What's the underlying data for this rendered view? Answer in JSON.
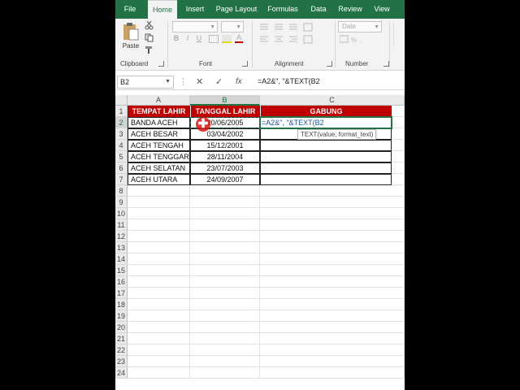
{
  "ribbon": {
    "tabs": [
      "File",
      "Home",
      "Insert",
      "Page Layout",
      "Formulas",
      "Data",
      "Review",
      "View"
    ],
    "active_tab": "Home",
    "groups": {
      "clipboard": "Clipboard",
      "font": "Font",
      "alignment": "Alignment",
      "number": "Number"
    },
    "paste_label": "Paste",
    "number_format": "Date",
    "bold": "B",
    "italic": "I",
    "underline": "U"
  },
  "formula_bar": {
    "name_box": "B2",
    "cancel": "✕",
    "enter": "✓",
    "fx": "fx",
    "formula": "=A2&\", \"&TEXT(B2"
  },
  "grid": {
    "columns": [
      "A",
      "B",
      "C"
    ],
    "rows": [
      "1",
      "2",
      "3",
      "4",
      "5",
      "6",
      "7",
      "8",
      "9",
      "10",
      "11",
      "12",
      "13",
      "14",
      "15",
      "16",
      "17",
      "18",
      "19",
      "20",
      "21",
      "22",
      "23",
      "24"
    ],
    "headers": [
      "TEMPAT LAHIR",
      "TANGGAL LAHIR",
      "GABUNG"
    ],
    "data": [
      {
        "tempat": "BANDA ACEH",
        "tanggal": "20/06/2005",
        "gabung": "=A2&\", \"&TEXT(B2"
      },
      {
        "tempat": "ACEH BESAR",
        "tanggal": "03/04/2002",
        "gabung": ""
      },
      {
        "tempat": "ACEH TENGAH",
        "tanggal": "15/12/2001",
        "gabung": ""
      },
      {
        "tempat": "ACEH TENGGARA",
        "tanggal": "28/11/2004",
        "gabung": ""
      },
      {
        "tempat": "ACEH SELATAN",
        "tanggal": "23/07/2003",
        "gabung": ""
      },
      {
        "tempat": "ACEH UTARA",
        "tanggal": "24/09/2007",
        "gabung": ""
      }
    ],
    "tooltip": "TEXT(value; format_text)"
  },
  "colors": {
    "accent": "#217346",
    "header_fill": "#c00000"
  }
}
